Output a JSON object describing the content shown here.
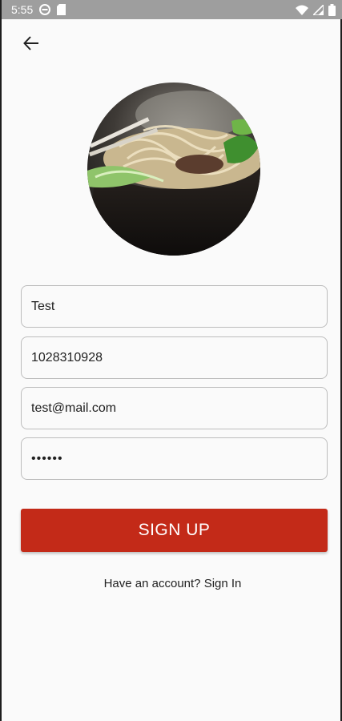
{
  "status_bar": {
    "time": "5:55",
    "icons": [
      "do-not-disturb-icon",
      "sd-card-icon",
      "wifi-icon",
      "signal-icon",
      "battery-icon"
    ]
  },
  "nav": {
    "back_icon": "arrow-back-icon"
  },
  "hero_image": {
    "subject": "noodle-bowl-photo"
  },
  "form": {
    "name_value": "Test",
    "phone_value": "1028310928",
    "email_value": "test@mail.com",
    "password_value": "••••••"
  },
  "signup_button": {
    "label": "SIGN UP",
    "color": "#c32a18"
  },
  "footer": {
    "prompt": "Have an account?",
    "link": "Sign In"
  },
  "colors": {
    "status_bar": "#9e9e9e",
    "background": "#fafafa",
    "field_border": "#bdbdbd"
  }
}
